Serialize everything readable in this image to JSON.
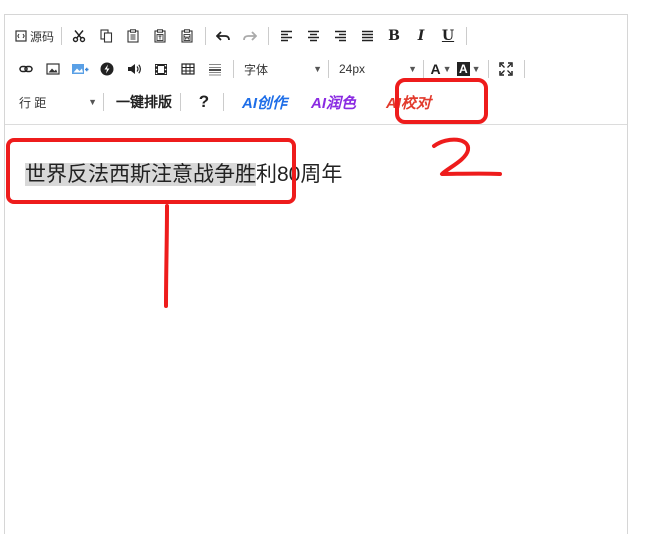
{
  "toolbar": {
    "source_label": "源码",
    "font_label": "字体",
    "font_size": "24px",
    "line_height_label": "行 距",
    "one_click_format": "一键排版",
    "help": "?",
    "ai_create": "AI创作",
    "ai_polish": "AI润色",
    "ai_proofread": "AI校对",
    "colors": {
      "ai_create": "#1e6ee8",
      "ai_polish": "#8a2be2",
      "ai_proofread": "#e23a2c"
    }
  },
  "content": {
    "selected_text": "世界反法西斯注意战争胜",
    "rest_text": "利80周年"
  },
  "annotations": {
    "label_1": "1",
    "label_2": "2",
    "color": "#ee1c1c"
  }
}
